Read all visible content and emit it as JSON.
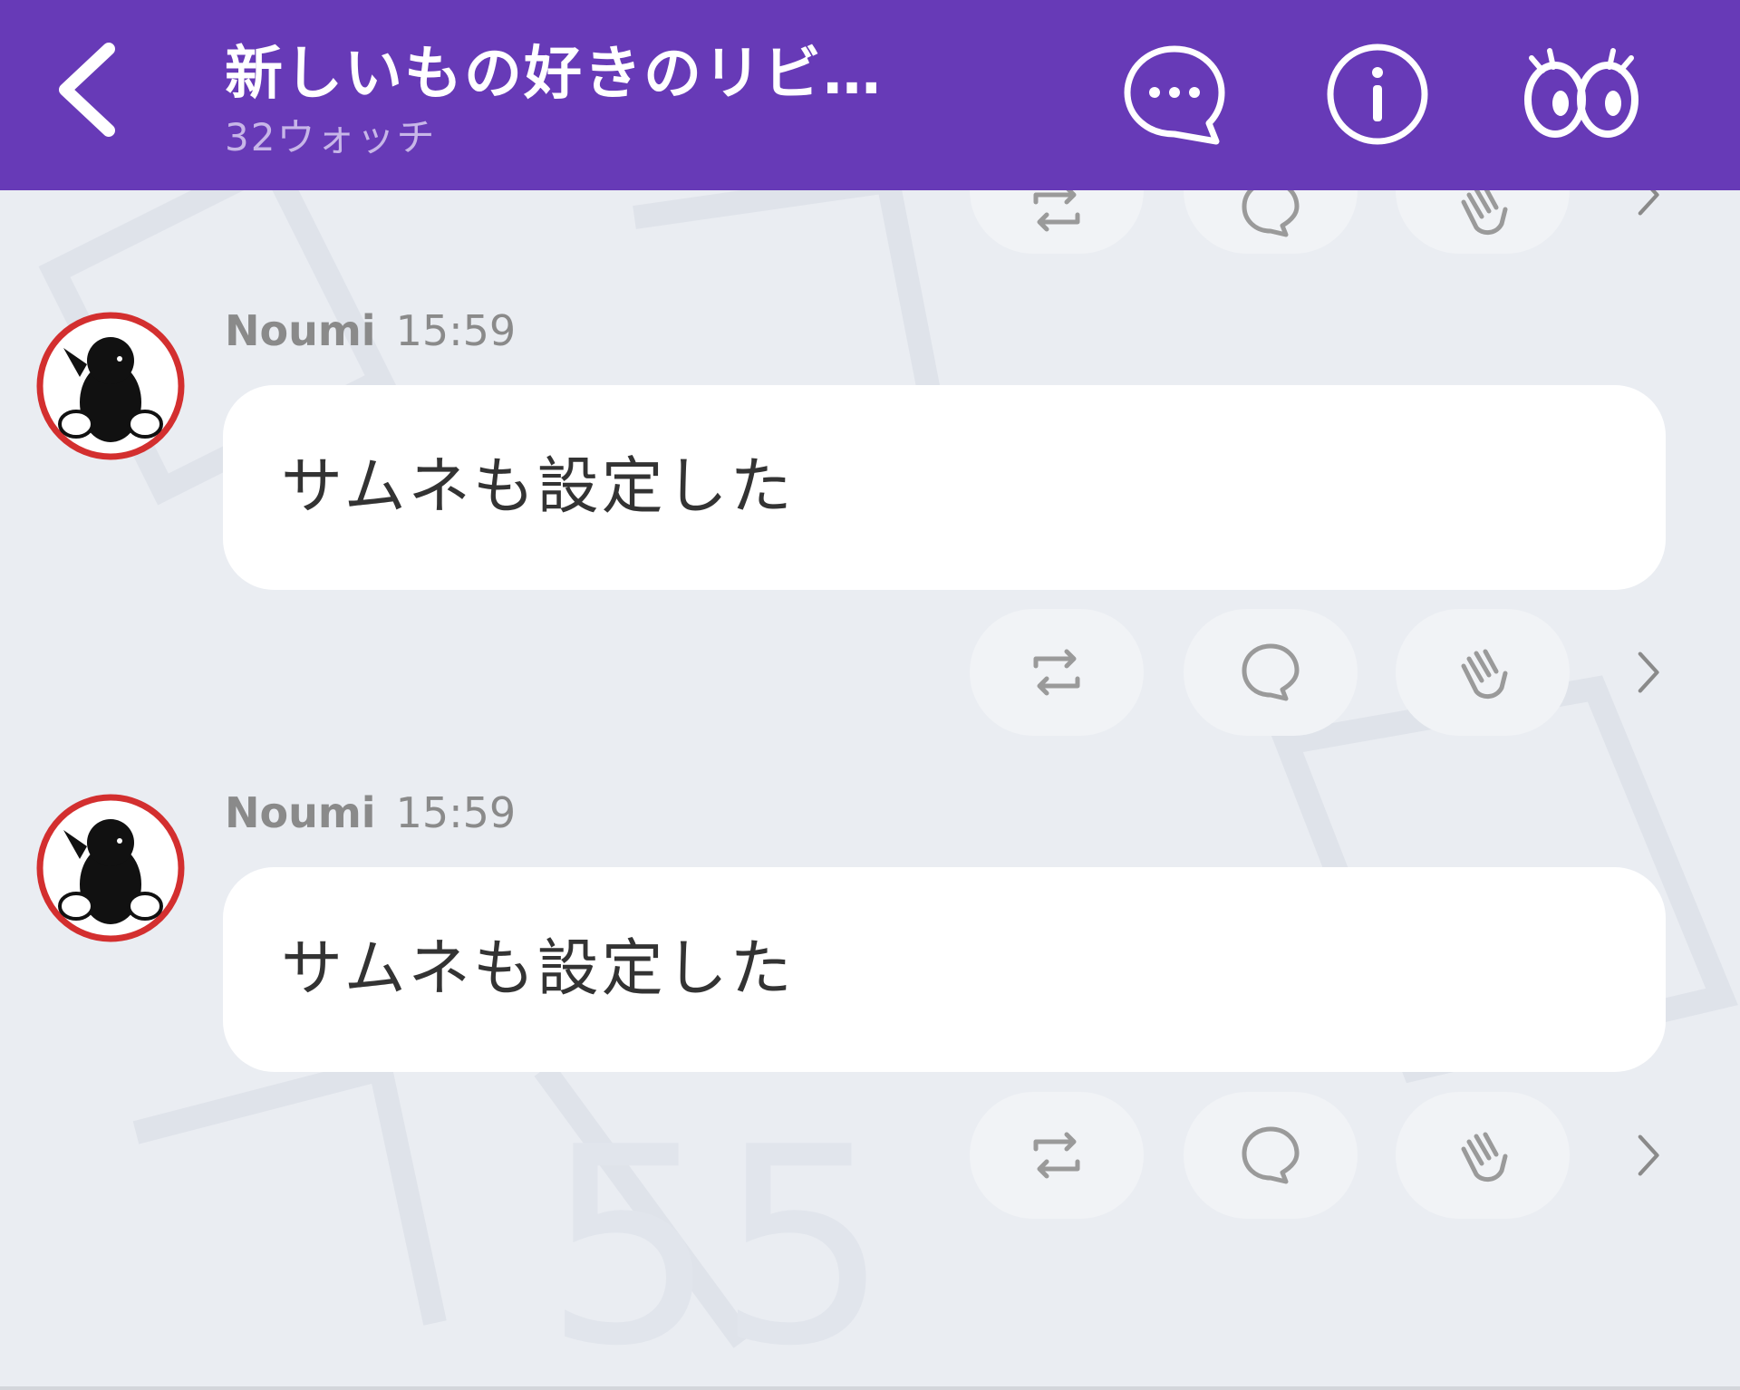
{
  "header": {
    "back_icon": "chevron-left-icon",
    "title": "新しいもの好きのリビ…",
    "subtitle": "32ウォッチ",
    "icons": [
      "comment-dots-icon",
      "info-icon",
      "watch-eyes-icon"
    ]
  },
  "colors": {
    "header_bg": "#673ab7",
    "page_bg": "#eaedf2",
    "bubble_bg": "#ffffff",
    "action_pill_bg": "#f1f3f6",
    "avatar_ring": "#d32f2f"
  },
  "messages": [
    {
      "author": "Noumi",
      "time": "15:59",
      "text": "サムネも設定した"
    },
    {
      "author": "Noumi",
      "time": "15:59",
      "text": "サムネも設定した"
    }
  ],
  "action_icons": [
    "repost-icon",
    "reply-icon",
    "clap-icon",
    "chevron-right-icon"
  ]
}
